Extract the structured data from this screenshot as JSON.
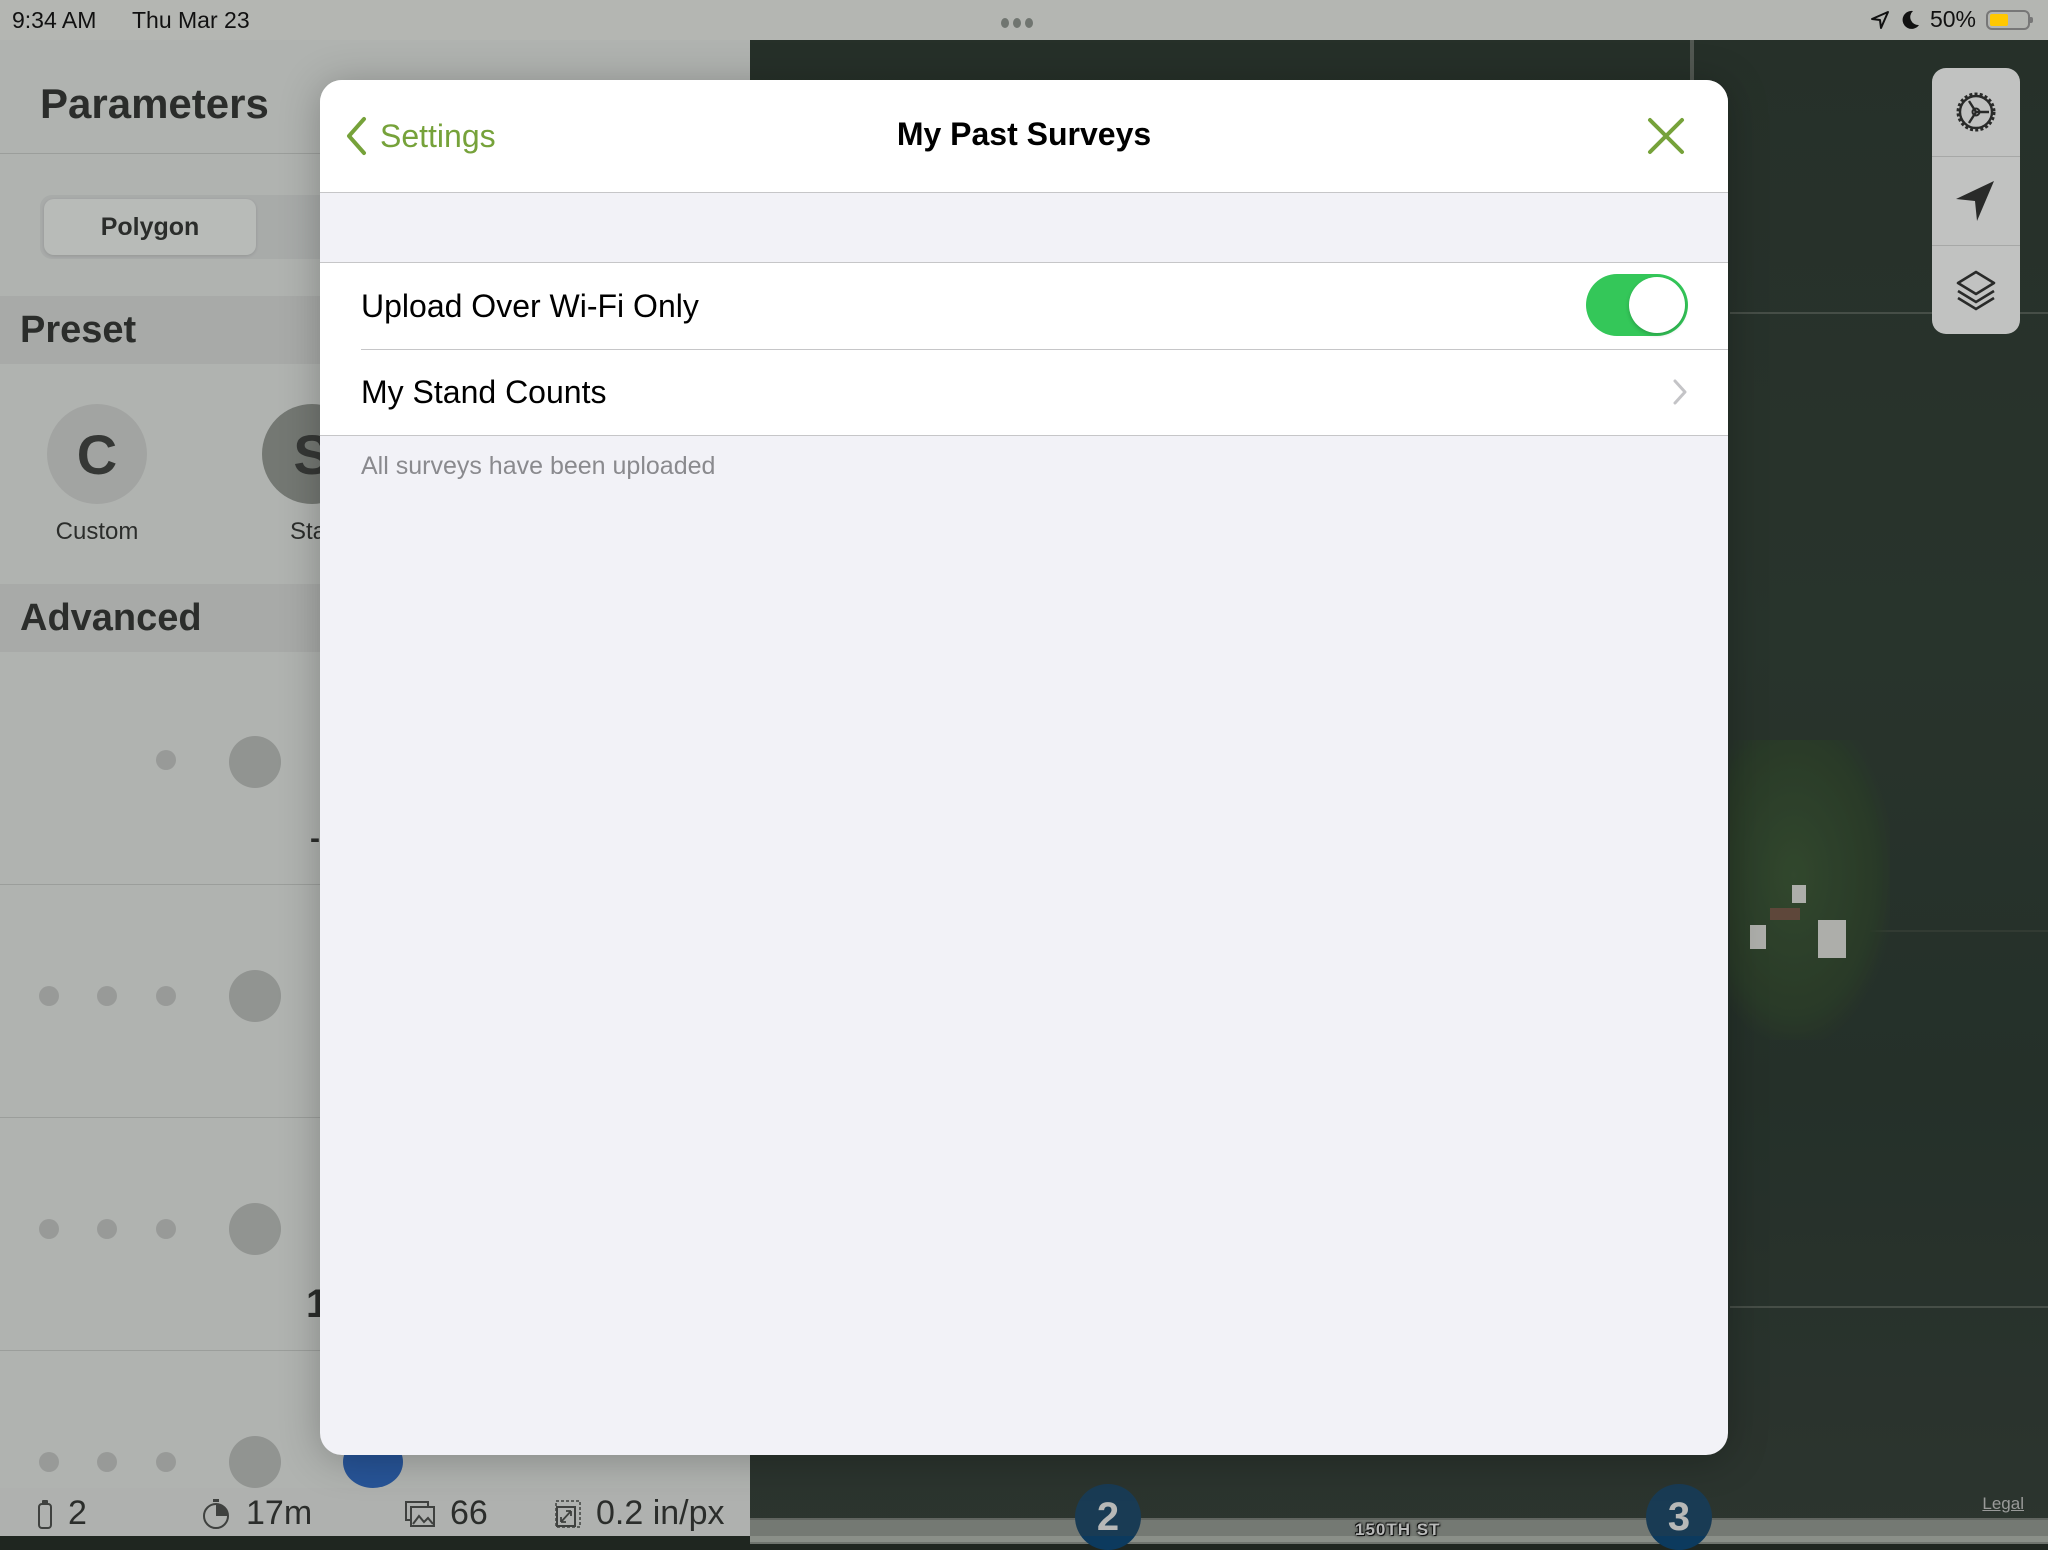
{
  "status_bar": {
    "time": "9:34 AM",
    "date": "Thu Mar 23",
    "battery_percent_label": "50%",
    "battery_level": 0.5,
    "icons": [
      "location-arrow-icon",
      "moon-icon",
      "battery-icon"
    ]
  },
  "left_panel": {
    "title": "Parameters",
    "segmented": {
      "selected": "Polygon"
    },
    "preset_section": "Preset",
    "presets": [
      {
        "letter": "C",
        "label": "Custom"
      },
      {
        "letter": "S",
        "label": "Star"
      }
    ],
    "advanced_section": "Advanced",
    "row_fragments": [
      "-",
      "1"
    ]
  },
  "bottom_bar": {
    "batteries": "2",
    "duration": "17m",
    "photos": "66",
    "resolution": "0.2 in/px"
  },
  "map": {
    "road_label": "150TH ST",
    "waypoints": [
      "2",
      "3"
    ],
    "legal_label": "Legal",
    "controls": [
      "settings-gear-icon",
      "location-arrow-icon",
      "layers-icon"
    ]
  },
  "modal": {
    "back_label": "Settings",
    "title": "My Past Surveys",
    "rows": [
      {
        "label": "Upload Over Wi-Fi Only",
        "type": "toggle",
        "value": true
      },
      {
        "label": "My Stand Counts",
        "type": "disclosure"
      }
    ],
    "footer_note": "All surveys have been uploaded",
    "accent_color": "#76a23a",
    "toggle_on_color": "#34c759"
  }
}
